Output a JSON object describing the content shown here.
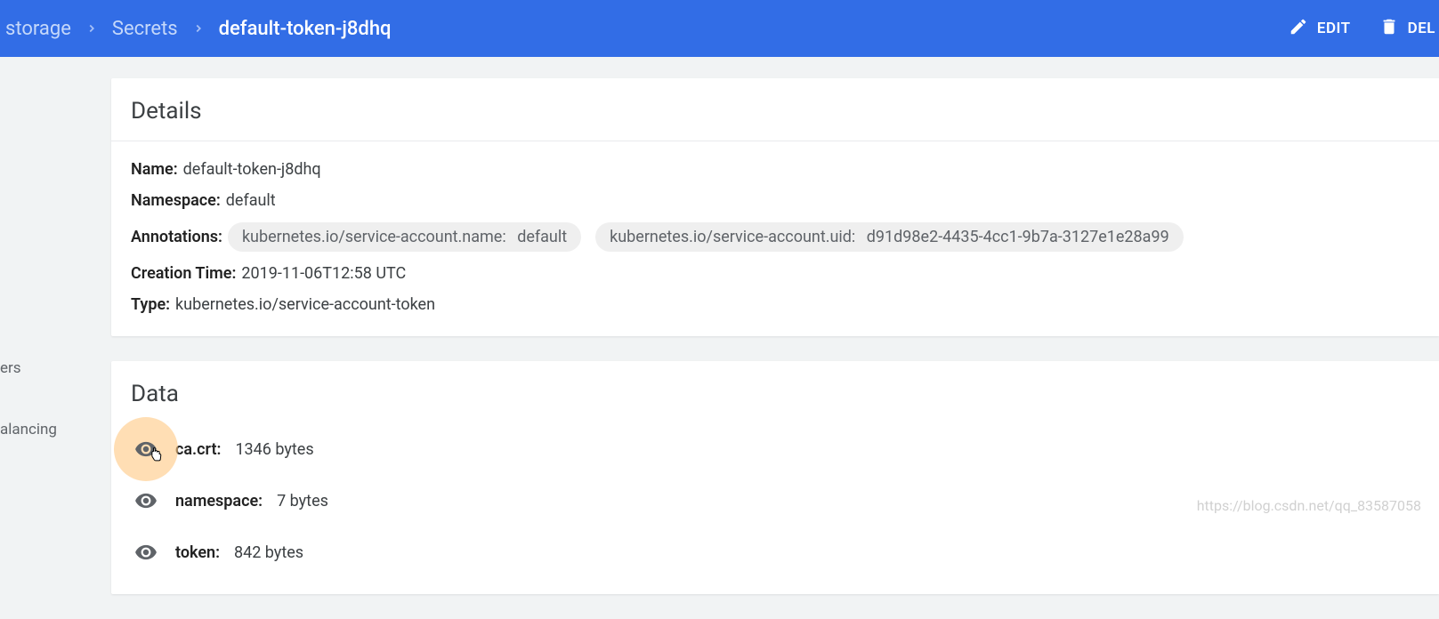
{
  "breadcrumb": {
    "items": [
      "storage",
      "Secrets",
      "default-token-j8dhq"
    ]
  },
  "header": {
    "edit_label": "EDIT",
    "delete_label": "DEL"
  },
  "sidebar": {
    "frag1": "ers",
    "frag2": "alancing"
  },
  "details": {
    "title": "Details",
    "name_label": "Name:",
    "name_value": "default-token-j8dhq",
    "namespace_label": "Namespace:",
    "namespace_value": "default",
    "annotations_label": "Annotations:",
    "annotations": [
      {
        "key": "kubernetes.io/service-account.name:",
        "value": "default"
      },
      {
        "key": "kubernetes.io/service-account.uid:",
        "value": "d91d98e2-4435-4cc1-9b7a-3127e1e28a99"
      }
    ],
    "creation_label": "Creation Time:",
    "creation_value": "2019-11-06T12:58 UTC",
    "type_label": "Type:",
    "type_value": "kubernetes.io/service-account-token"
  },
  "data": {
    "title": "Data",
    "items": [
      {
        "key": "ca.crt:",
        "value": "1346 bytes"
      },
      {
        "key": "namespace:",
        "value": "7 bytes"
      },
      {
        "key": "token:",
        "value": "842 bytes"
      }
    ]
  },
  "watermark": "https://blog.csdn.net/qq_83587058"
}
